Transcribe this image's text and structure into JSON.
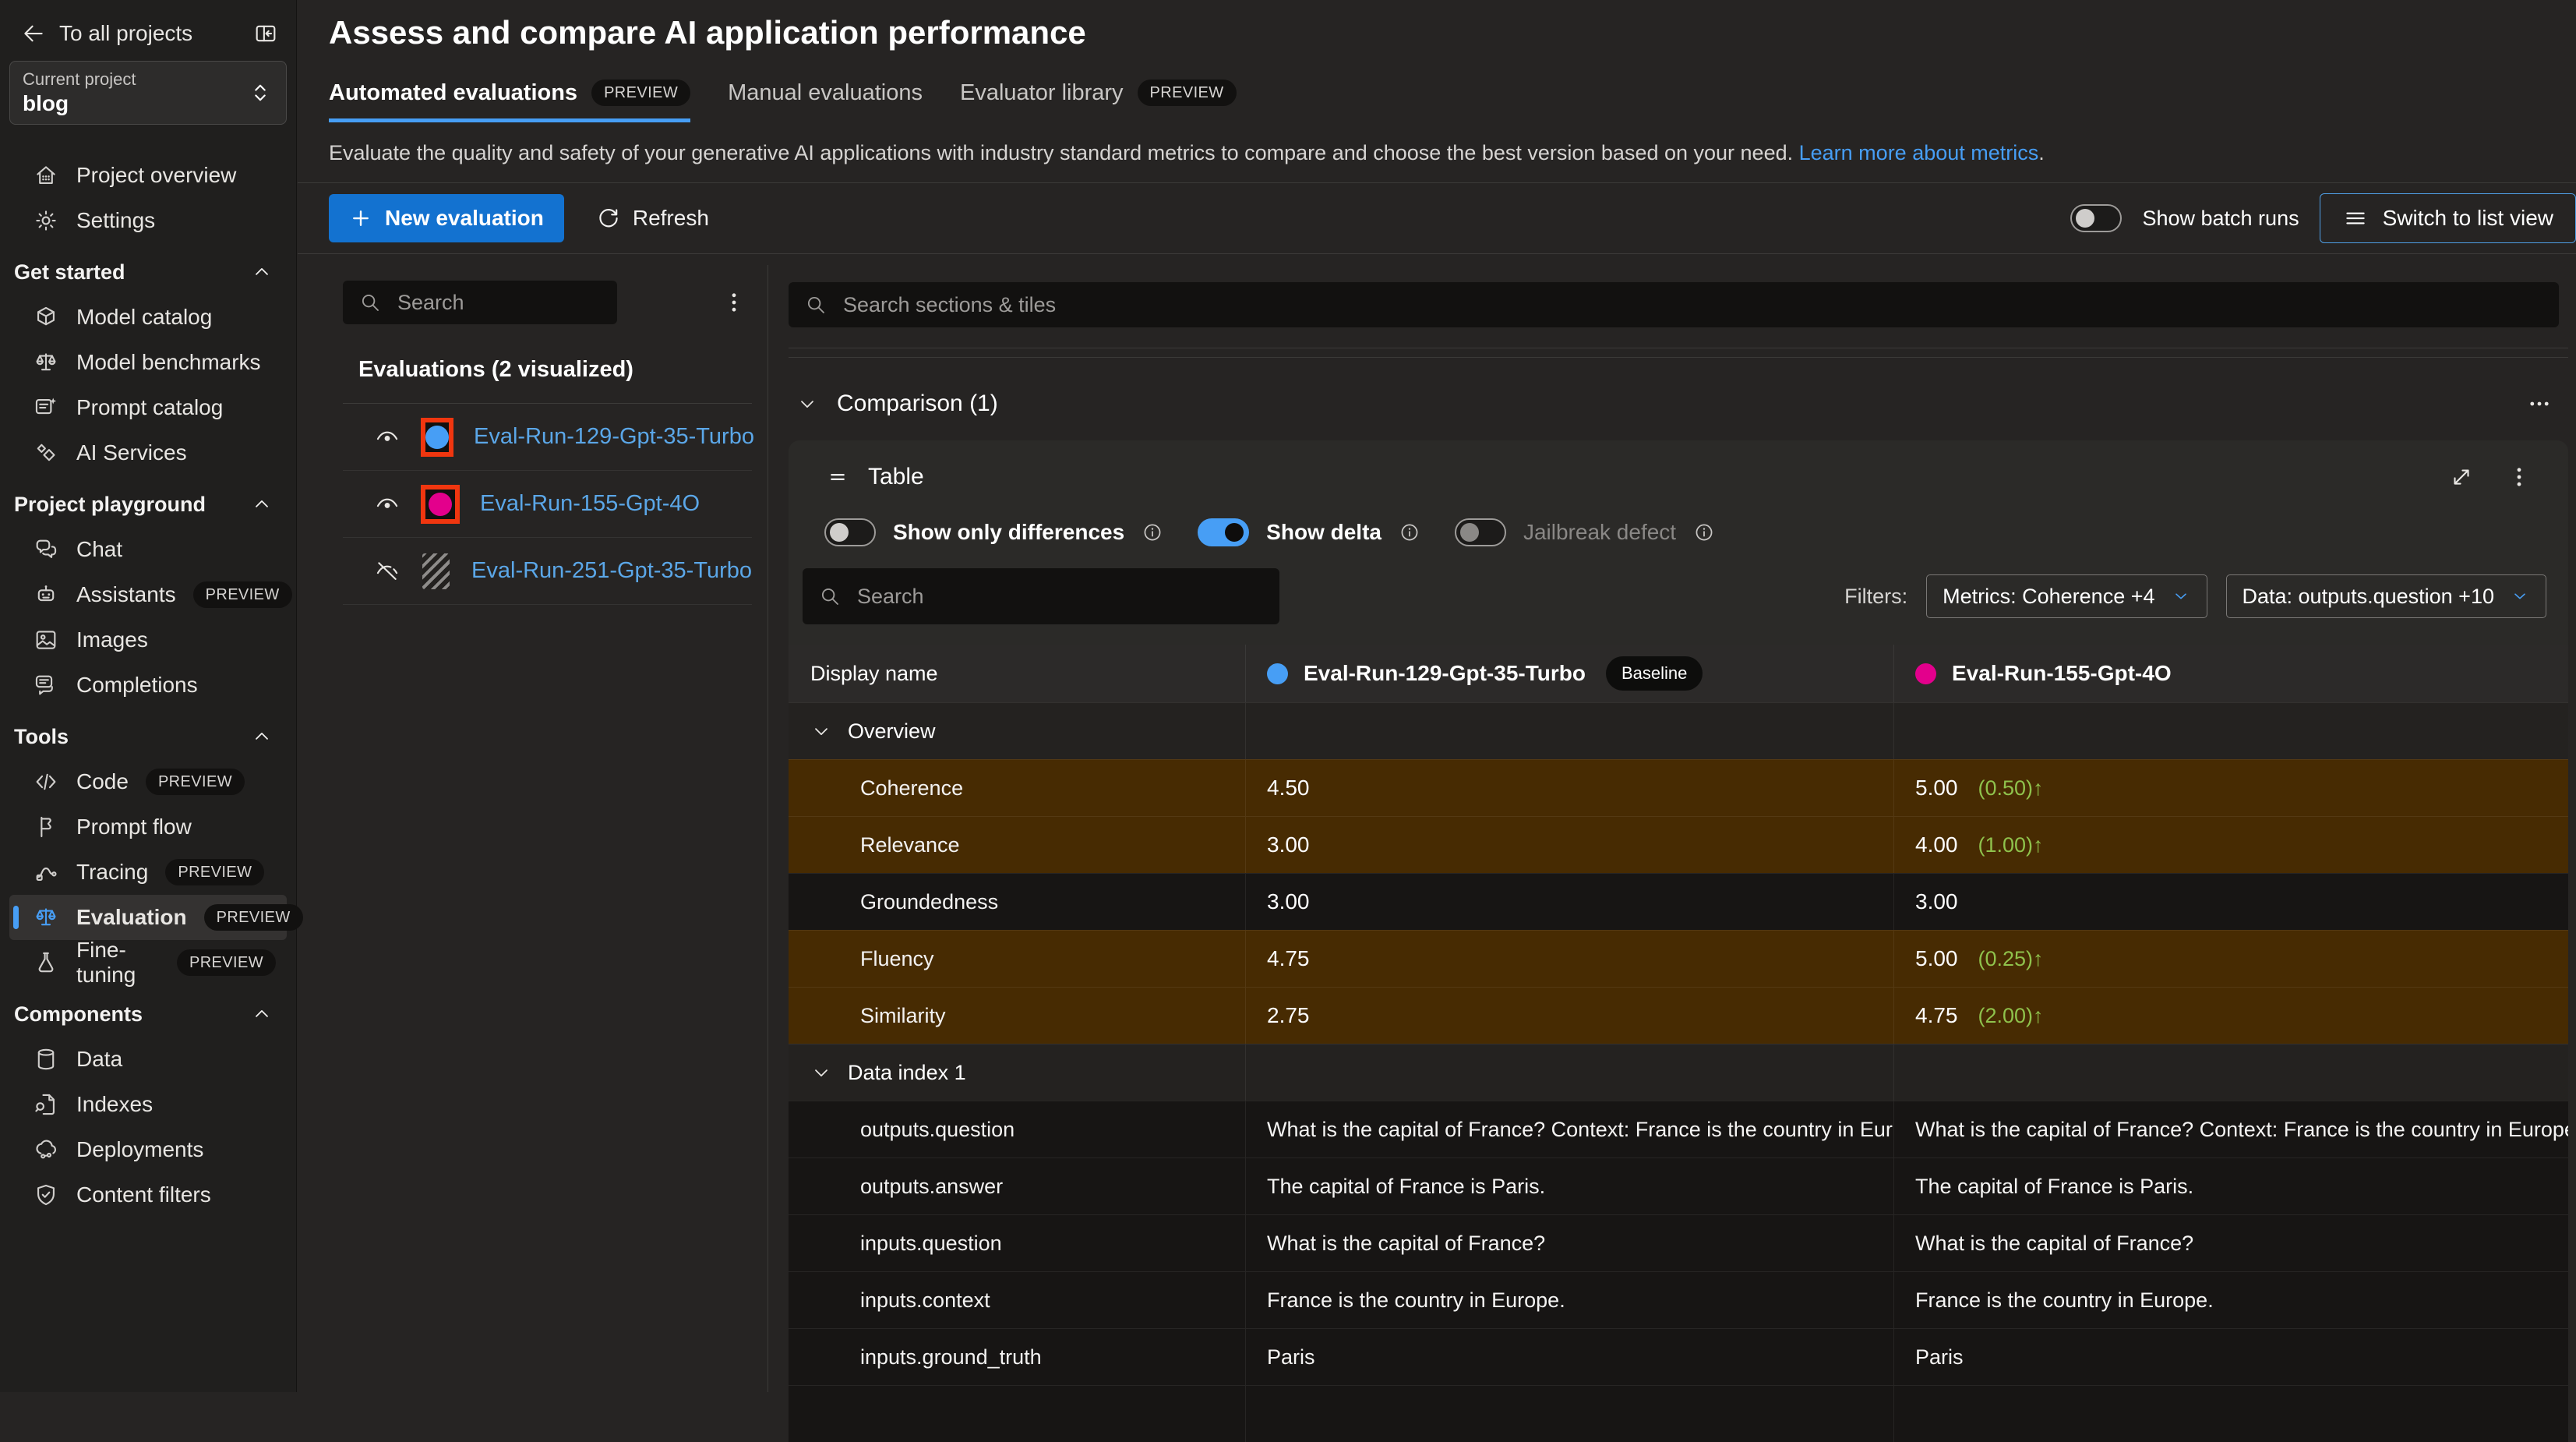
{
  "labels": {
    "preview": "PREVIEW"
  },
  "colors": {
    "accent": "#479ef5",
    "diff_row": "#472b02",
    "delta_green": "#8fc24c",
    "swatch_border_red": "#f0360f",
    "run1_blue": "#479ef5",
    "run2_pink": "#e3008c"
  },
  "sidebar": {
    "back_label": "To all projects",
    "project": {
      "label": "Current project",
      "name": "blog"
    },
    "groups": [
      {
        "header": null,
        "items": [
          {
            "label": "Project overview",
            "icon": "home"
          },
          {
            "label": "Settings",
            "icon": "gear"
          }
        ]
      },
      {
        "header": "Get started",
        "items": [
          {
            "label": "Model catalog",
            "icon": "cube"
          },
          {
            "label": "Model benchmarks",
            "icon": "scales"
          },
          {
            "label": "Prompt catalog",
            "icon": "prompt"
          },
          {
            "label": "AI Services",
            "icon": "diamonds"
          }
        ]
      },
      {
        "header": "Project playground",
        "items": [
          {
            "label": "Chat",
            "icon": "chat"
          },
          {
            "label": "Assistants",
            "icon": "robot",
            "preview": true
          },
          {
            "label": "Images",
            "icon": "image"
          },
          {
            "label": "Completions",
            "icon": "completions"
          }
        ]
      },
      {
        "header": "Tools",
        "items": [
          {
            "label": "Code",
            "icon": "code",
            "preview": true
          },
          {
            "label": "Prompt flow",
            "icon": "flow"
          },
          {
            "label": "Tracing",
            "icon": "tracing",
            "preview": true
          },
          {
            "label": "Evaluation",
            "icon": "scales",
            "preview": true,
            "selected": true
          },
          {
            "label": "Fine-tuning",
            "icon": "flask",
            "preview": true
          }
        ]
      },
      {
        "header": "Components",
        "items": [
          {
            "label": "Data",
            "icon": "database"
          },
          {
            "label": "Indexes",
            "icon": "docsearch"
          },
          {
            "label": "Deployments",
            "icon": "cloud"
          },
          {
            "label": "Content filters",
            "icon": "shield"
          }
        ]
      }
    ]
  },
  "header": {
    "title": "Assess and compare AI application performance",
    "tabs": [
      {
        "label": "Automated evaluations",
        "preview": true,
        "active": true
      },
      {
        "label": "Manual evaluations",
        "preview": false,
        "active": false
      },
      {
        "label": "Evaluator library",
        "preview": true,
        "active": false
      }
    ],
    "description": "Evaluate the quality and safety of your generative AI applications with industry standard metrics to compare and choose the best version based on your need. ",
    "link": "Learn more about metrics",
    "period": "."
  },
  "toolbar": {
    "new_evaluation": "New evaluation",
    "refresh": "Refresh",
    "show_batch_runs": "Show batch runs",
    "switch_view": "Switch to list view"
  },
  "eval_panel": {
    "search_placeholder": "Search",
    "heading": "Evaluations (2 visualized)",
    "runs": [
      {
        "name": "Eval-Run-129-Gpt-35-Turbo",
        "color": "#479ef5",
        "visualized": true
      },
      {
        "name": "Eval-Run-155-Gpt-4O",
        "color": "#e3008c",
        "visualized": true
      },
      {
        "name": "Eval-Run-251-Gpt-35-Turbo",
        "color": "",
        "visualized": false
      }
    ]
  },
  "board": {
    "search_placeholder": "Search sections & tiles",
    "comparison_title": "Comparison (1)"
  },
  "tile": {
    "title": "Table",
    "toggles": [
      {
        "label": "Show only differences",
        "on": false,
        "disabled": false
      },
      {
        "label": "Show delta",
        "on": true,
        "disabled": false
      },
      {
        "label": "Jailbreak defect",
        "on": false,
        "disabled": true
      }
    ],
    "search_placeholder": "Search",
    "filters_label": "Filters:",
    "filters": [
      "Metrics: Coherence +4",
      "Data: outputs.question +10"
    ],
    "table": {
      "display_name": "Display name",
      "runs": [
        {
          "name": "Eval-Run-129-Gpt-35-Turbo",
          "badge": "Baseline",
          "color": "#479ef5"
        },
        {
          "name": "Eval-Run-155-Gpt-4O",
          "badge": "",
          "color": "#e3008c"
        }
      ],
      "sections": [
        {
          "label": "Overview",
          "rows": [
            {
              "metric": "Coherence",
              "baseline": "4.50",
              "candidate": "5.00",
              "delta": "(0.50)",
              "arrow": "↑",
              "diff": true
            },
            {
              "metric": "Relevance",
              "baseline": "3.00",
              "candidate": "4.00",
              "delta": "(1.00)",
              "arrow": "↑",
              "diff": true
            },
            {
              "metric": "Groundedness",
              "baseline": "3.00",
              "candidate": "3.00",
              "delta": "",
              "arrow": "",
              "diff": false
            },
            {
              "metric": "Fluency",
              "baseline": "4.75",
              "candidate": "5.00",
              "delta": "(0.25)",
              "arrow": "↑",
              "diff": true
            },
            {
              "metric": "Similarity",
              "baseline": "2.75",
              "candidate": "4.75",
              "delta": "(2.00)",
              "arrow": "↑",
              "diff": true
            }
          ]
        },
        {
          "label": "Data index 1",
          "rows": [
            {
              "metric": "outputs.question",
              "baseline": "What is the capital of France? Context: France is the country in Europe.",
              "candidate": "What is the capital of France? Context: France is the country in Europe.",
              "delta": "",
              "arrow": "",
              "diff": false
            },
            {
              "metric": "outputs.answer",
              "baseline": "The capital of France is Paris.",
              "candidate": "The capital of France is Paris.",
              "delta": "",
              "arrow": "",
              "diff": false
            },
            {
              "metric": "inputs.question",
              "baseline": "What is the capital of France?",
              "candidate": "What is the capital of France?",
              "delta": "",
              "arrow": "",
              "diff": false
            },
            {
              "metric": "inputs.context",
              "baseline": "France is the country in Europe.",
              "candidate": "France is the country in Europe.",
              "delta": "",
              "arrow": "",
              "diff": false
            },
            {
              "metric": "inputs.ground_truth",
              "baseline": "Paris",
              "candidate": "Paris",
              "delta": "",
              "arrow": "",
              "diff": false
            }
          ]
        }
      ]
    }
  }
}
